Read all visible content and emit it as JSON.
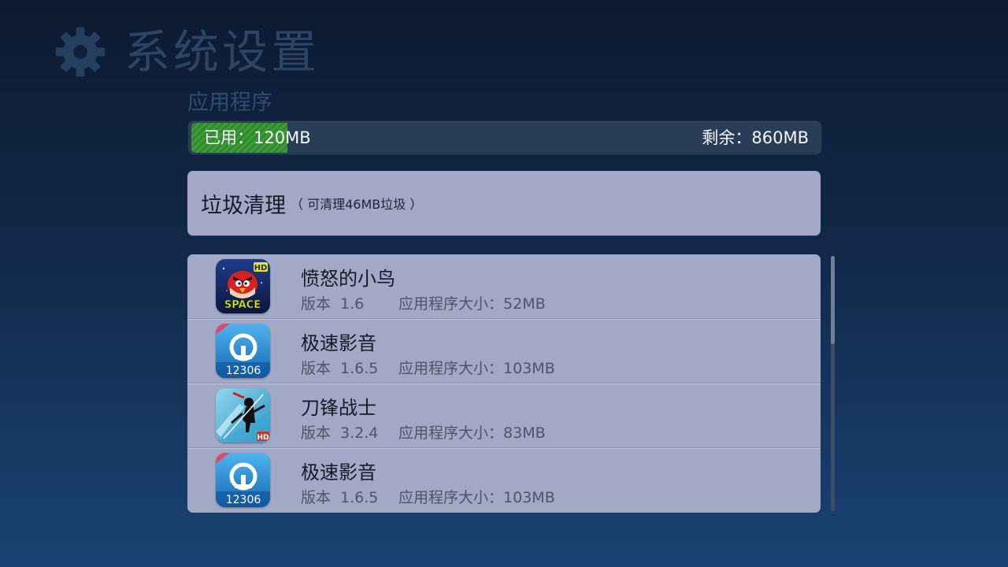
{
  "header": {
    "title": "系统设置",
    "icon": "gear-icon"
  },
  "page": {
    "subtitle": "应用程序"
  },
  "storage": {
    "used_text": "已用：120MB",
    "free_text": "剩余：860MB",
    "used_fraction": 0.12,
    "fill_color": "#3f9a3a"
  },
  "junk_cleanup": {
    "title": "垃圾清理",
    "hint": "（ 可清理46MB垃圾 ）"
  },
  "apps": [
    {
      "name": "愤怒的小鸟",
      "version_label": "版本",
      "version": "1.6",
      "size_label": "应用程序大小：",
      "size": "52MB",
      "icon": "angry-birds-space-icon"
    },
    {
      "name": "极速影音",
      "version_label": "版本",
      "version": "1.6.5",
      "size_label": "应用程序大小：",
      "size": "103MB",
      "icon": "railway-12306-icon",
      "icon_text": "12306"
    },
    {
      "name": "刀锋战士",
      "version_label": "版本",
      "version": "3.2.4",
      "size_label": "应用程序大小：",
      "size": "83MB",
      "icon": "blade-warrior-icon"
    },
    {
      "name": "极速影音",
      "version_label": "版本",
      "version": "1.6.5",
      "size_label": "应用程序大小：",
      "size": "103MB",
      "icon": "railway-12306-icon",
      "icon_text": "12306"
    }
  ],
  "icon_badges": {
    "hd": "HD",
    "space": "SPACE"
  },
  "colors": {
    "accent_green": "#3f9a3a",
    "panel": "#a2a9c7",
    "background_top": "#0c1a30",
    "background_bottom": "#1a4373"
  }
}
